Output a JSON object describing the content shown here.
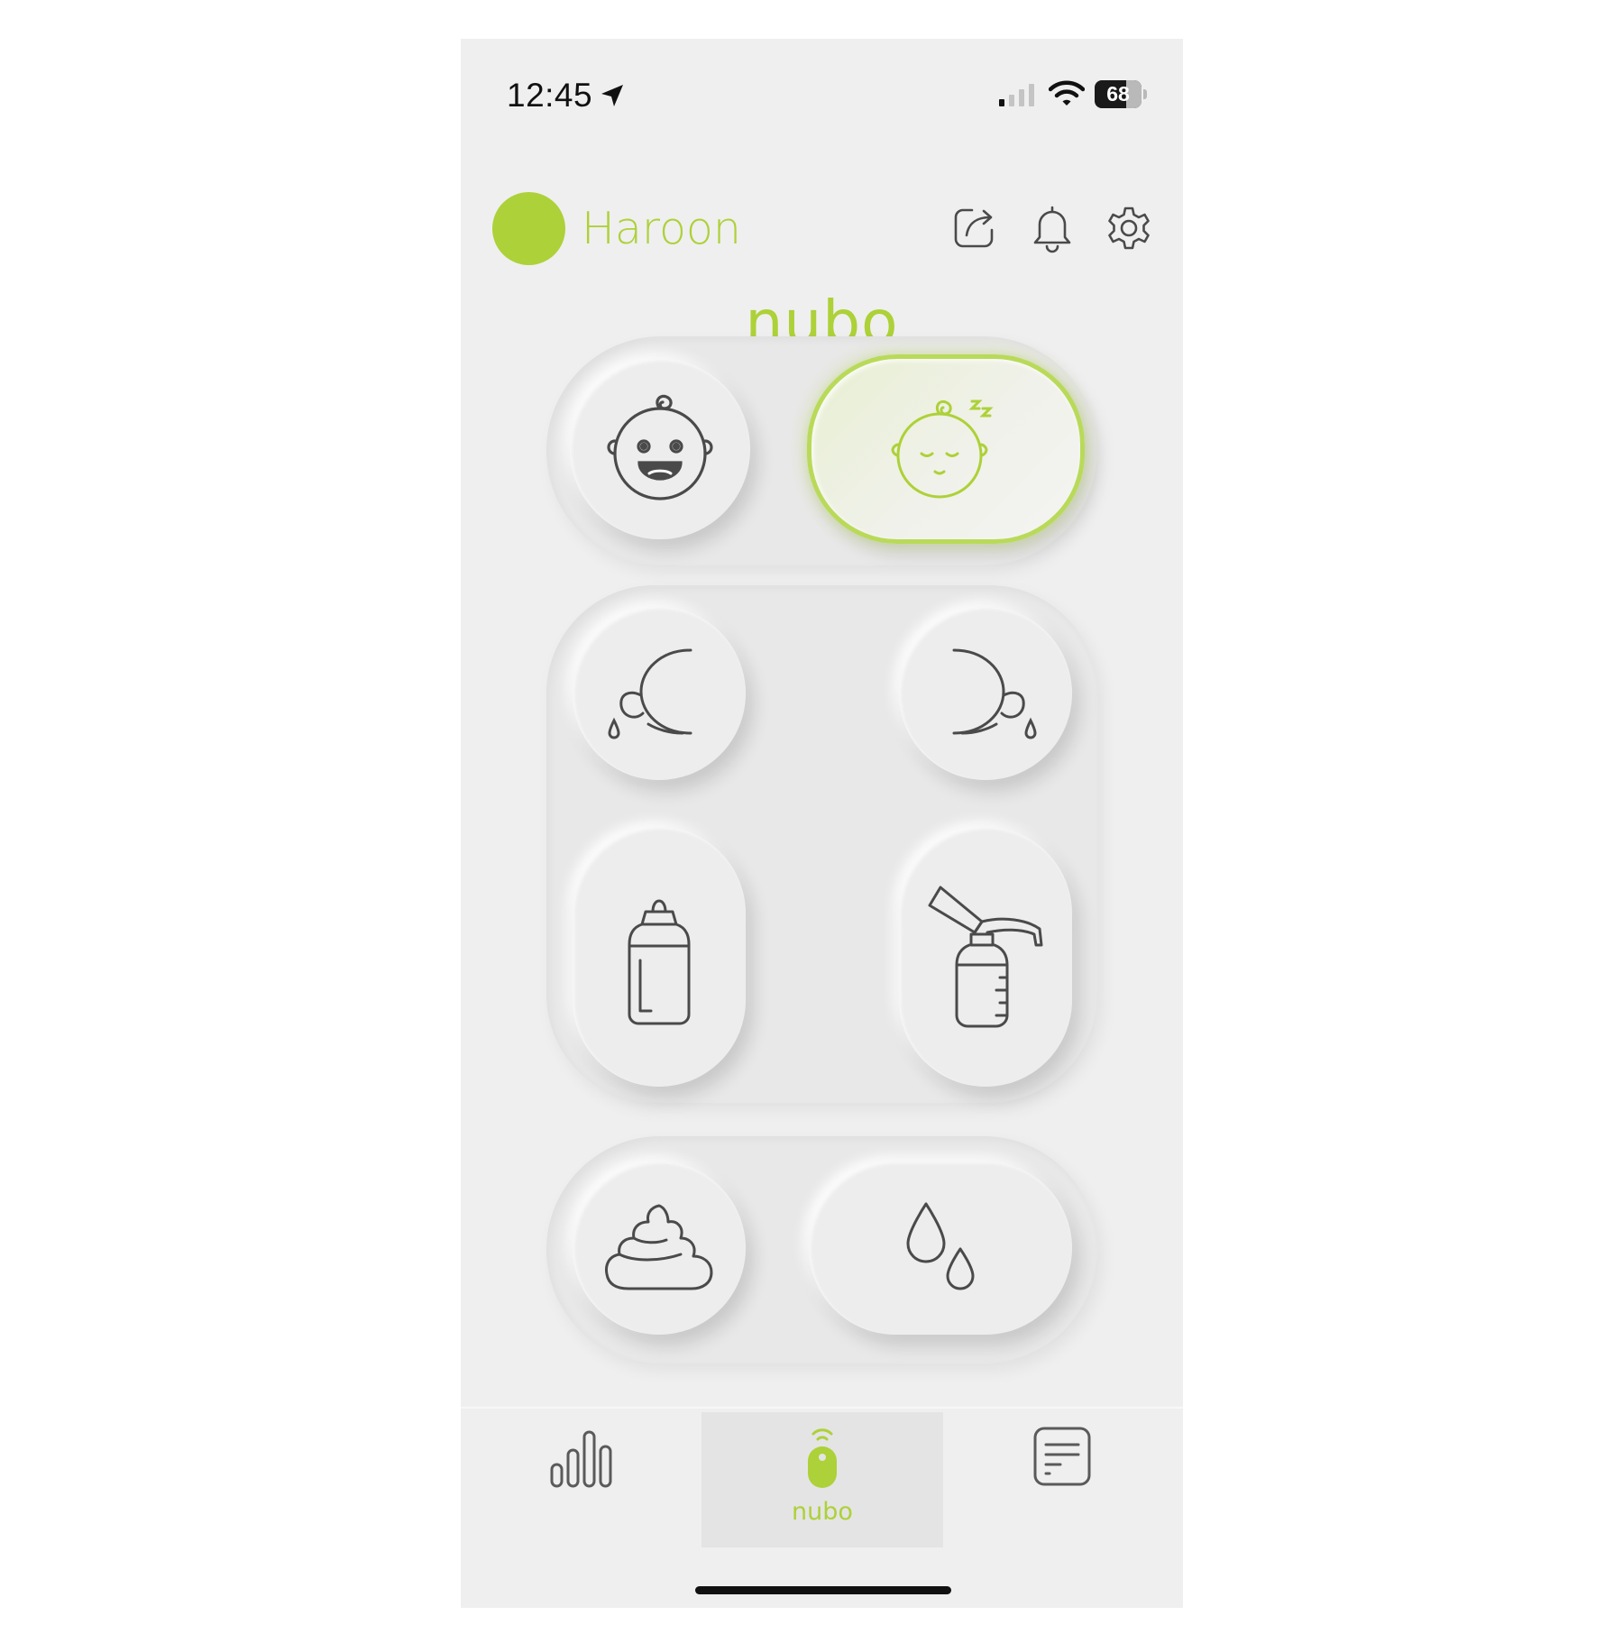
{
  "status_bar": {
    "time": "12:45",
    "battery_percent": "68",
    "battery_level": 0.68
  },
  "header": {
    "user_name": "Haroon",
    "avatar_color": "#add138",
    "icons": [
      "share-icon",
      "bell-icon",
      "gear-icon"
    ]
  },
  "brand": {
    "name": "nubo",
    "accent_color": "#add138"
  },
  "actions": {
    "awake": {
      "icon": "awake-baby-icon",
      "selected": false
    },
    "asleep": {
      "icon": "sleeping-baby-icon",
      "selected": true
    },
    "breastfeed_left": {
      "icon": "breastfeed-left-icon"
    },
    "breastfeed_right": {
      "icon": "breastfeed-right-icon"
    },
    "bottle": {
      "icon": "baby-bottle-icon"
    },
    "pump": {
      "icon": "breast-pump-icon"
    },
    "poop": {
      "icon": "poop-icon"
    },
    "pee": {
      "icon": "droplets-icon"
    }
  },
  "tabbar": {
    "tabs": [
      {
        "id": "stats",
        "icon": "bar-chart-icon",
        "label": ""
      },
      {
        "id": "nubo",
        "icon": "remote-device-icon",
        "label": "nubo",
        "selected": true
      },
      {
        "id": "log",
        "icon": "list-icon",
        "label": ""
      }
    ]
  }
}
